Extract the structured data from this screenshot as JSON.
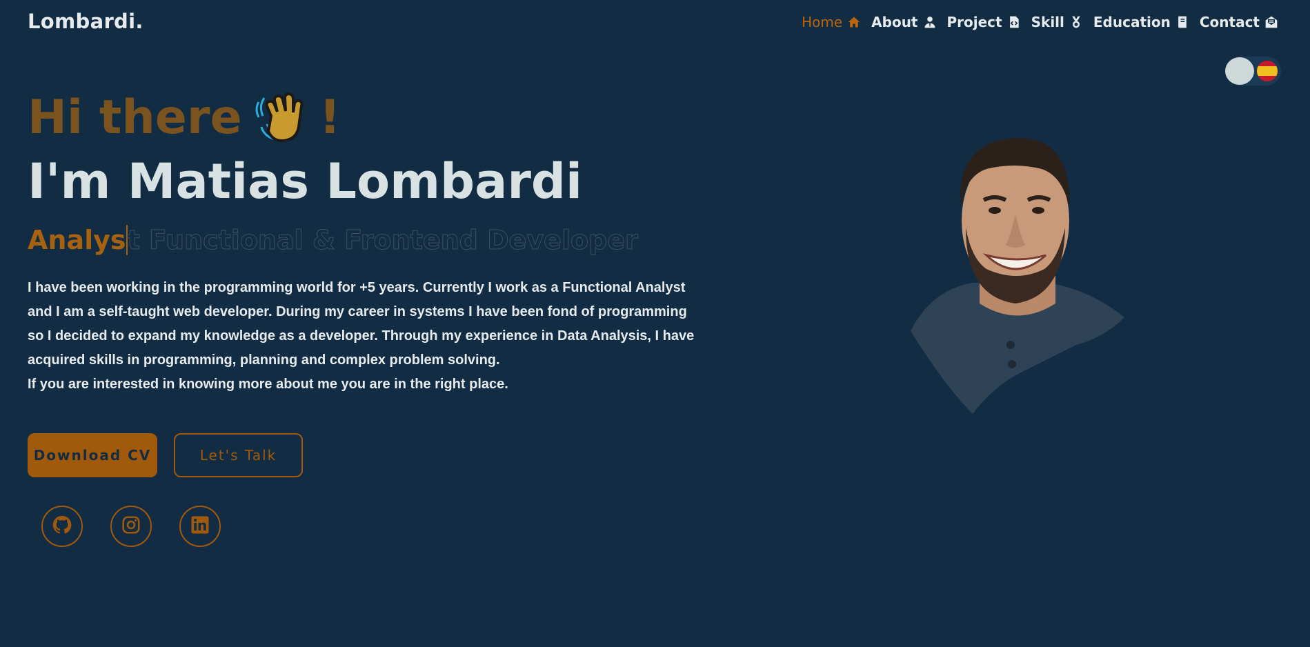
{
  "header": {
    "logo": "Lombardi.",
    "nav": [
      {
        "label": "Home",
        "icon": "home-icon",
        "active": true
      },
      {
        "label": "About",
        "icon": "user-icon",
        "active": false
      },
      {
        "label": "Project",
        "icon": "code-file-icon",
        "active": false
      },
      {
        "label": "Skill",
        "icon": "medal-icon",
        "active": false
      },
      {
        "label": "Education",
        "icon": "book-icon",
        "active": false
      },
      {
        "label": "Contact",
        "icon": "mail-icon",
        "active": false
      }
    ]
  },
  "language_toggle": {
    "flag": "spain-flag-icon"
  },
  "hero": {
    "greeting_prefix": "Hi there",
    "greeting_suffix": "!",
    "name": "I'm Matias Lombardi",
    "role_typed": "Analys",
    "role_rest": "t Functional & Frontend Developer",
    "bio": [
      "I have been working in the programming world for +5 years. Currently I work as a Functional Analyst",
      "and I am a self-taught web developer. During my career in systems I have been fond of programming",
      "so I decided to expand my knowledge as a developer. Through my experience in Data Analysis, I have",
      "acquired skills in programming, planning and complex problem solving.",
      "If you are interested in knowing more about me you are in the right place."
    ],
    "buttons": {
      "download": "Download CV",
      "talk": "Let's Talk"
    },
    "social": [
      "github-icon",
      "instagram-icon",
      "linkedin-icon"
    ]
  },
  "colors": {
    "background": "#122c44",
    "accent": "#a15a0c",
    "text": "#e6ecee"
  }
}
